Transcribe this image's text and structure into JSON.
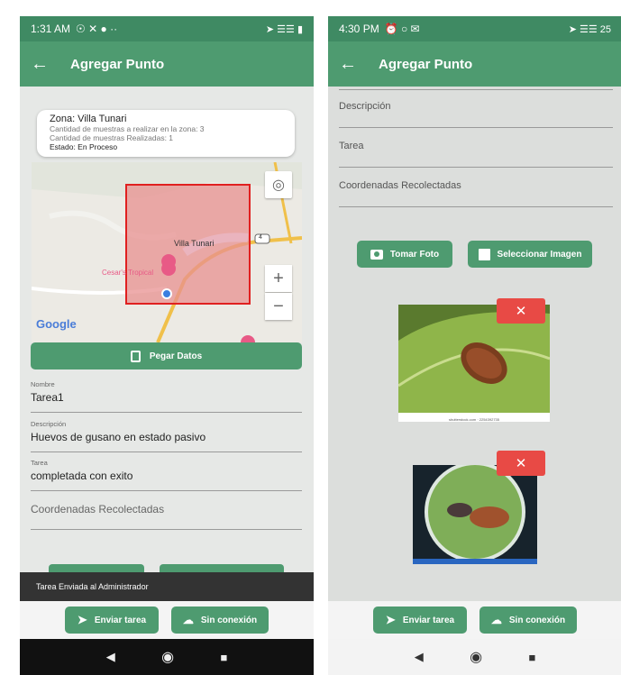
{
  "left": {
    "status": {
      "time": "1:31 AM",
      "icons_left": "☉ ✕ ● ··",
      "icons_right": "➤ ☰☰ ▮"
    },
    "appbar": {
      "back": "←",
      "title": "Agregar Punto"
    },
    "zone": {
      "name": "Zona: Villa Tunari",
      "line1": "Cantidad de muestras a realizar en la zona: 3",
      "line2": "Cantidad de muestras Realizadas: 1",
      "state": "Estado: En Proceso"
    },
    "map": {
      "label_place": "Villa Tunari",
      "label_poi": "Cesar's Tropical",
      "road_number": "4",
      "google": "Google",
      "zoom_in": "+",
      "zoom_out": "−"
    },
    "paste_button": "Pegar Datos",
    "fields": [
      {
        "label": "Nombre",
        "value": "Tarea1"
      },
      {
        "label": "Descripción",
        "value": "Huevos de gusano en estado pasivo"
      },
      {
        "label": "Tarea",
        "value": "completada con exito"
      }
    ],
    "coords_placeholder": "Coordenadas Recolectadas",
    "snackbar": "Tarea Enviada al Administrador",
    "send_button": "Enviar tarea",
    "offline_button": "Sin conexión"
  },
  "right": {
    "status": {
      "time": "4:30 PM",
      "icons_left": "⏰ ○ ✉",
      "icons_right": "➤ ☰☰ 25"
    },
    "appbar": {
      "back": "←",
      "title": "Agregar Punto"
    },
    "fields": [
      "Descripción",
      "Tarea",
      "Coordenadas Recolectadas"
    ],
    "photo_button": "Tomar Foto",
    "select_button": "Seleccionar Imagen",
    "img1_caption": "shutterstock.com · 2254392735",
    "delete_label": "✕",
    "send_button": "Enviar tarea",
    "offline_button": "Sin conexión"
  },
  "colors": {
    "primary": "#4e9b70",
    "statusbar": "#3f8a63",
    "delete": "#e84a45",
    "zone_fill": "#e89090",
    "zone_border": "#e02020"
  },
  "icons": [
    "back-arrow-icon",
    "clipboard-icon",
    "location-target-icon",
    "send-icon",
    "cloud-off-icon",
    "camera-icon",
    "image-icon",
    "close-icon",
    "nav-back-icon",
    "nav-home-icon",
    "nav-recents-icon"
  ]
}
